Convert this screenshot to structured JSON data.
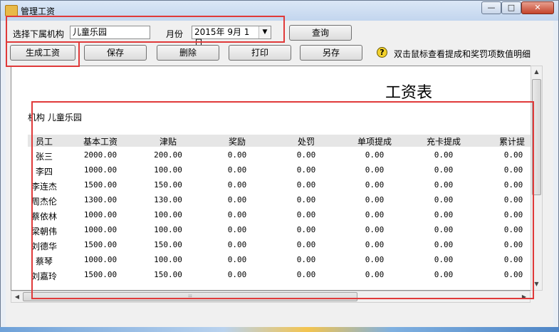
{
  "window": {
    "title": "管理工资",
    "controls": {
      "minimize": "—",
      "maximize": "□",
      "close": "✕"
    }
  },
  "filters": {
    "org_label": "选择下属机构",
    "org_value": "儿童乐园",
    "month_label": "月份",
    "month_value": "2015年 9月 1日",
    "query_button": "查询"
  },
  "toolbar": {
    "generate": "生成工资",
    "save": "保存",
    "delete": "删除",
    "print": "打印",
    "save_as": "另存",
    "hint": "双击鼠标查看提成和奖罚项数值明细"
  },
  "report": {
    "title": "工资表",
    "org_line": "机构 儿童乐园",
    "columns": [
      "员工",
      "基本工资",
      "津贴",
      "奖励",
      "处罚",
      "单项提成",
      "充卡提成",
      "累计提"
    ],
    "rows": [
      [
        "张三",
        "2000.00",
        "200.00",
        "0.00",
        "0.00",
        "0.00",
        "0.00",
        "0.00"
      ],
      [
        "李四",
        "1000.00",
        "100.00",
        "0.00",
        "0.00",
        "0.00",
        "0.00",
        "0.00"
      ],
      [
        "李连杰",
        "1500.00",
        "150.00",
        "0.00",
        "0.00",
        "0.00",
        "0.00",
        "0.00"
      ],
      [
        "周杰伦",
        "1300.00",
        "130.00",
        "0.00",
        "0.00",
        "0.00",
        "0.00",
        "0.00"
      ],
      [
        "蔡依林",
        "1000.00",
        "100.00",
        "0.00",
        "0.00",
        "0.00",
        "0.00",
        "0.00"
      ],
      [
        "梁朝伟",
        "1000.00",
        "100.00",
        "0.00",
        "0.00",
        "0.00",
        "0.00",
        "0.00"
      ],
      [
        "刘德华",
        "1500.00",
        "150.00",
        "0.00",
        "0.00",
        "0.00",
        "0.00",
        "0.00"
      ],
      [
        "蔡琴",
        "1000.00",
        "100.00",
        "0.00",
        "0.00",
        "0.00",
        "0.00",
        "0.00"
      ],
      [
        "刘嘉玲",
        "1500.00",
        "150.00",
        "0.00",
        "0.00",
        "0.00",
        "0.00",
        "0.00"
      ]
    ]
  },
  "scrollbar": {
    "h_grip": "⦙⦙⦙",
    "up": "▲",
    "down": "▼",
    "left": "◀",
    "right": "▶"
  },
  "icons": {
    "help": "?",
    "dropdown": "▼"
  }
}
